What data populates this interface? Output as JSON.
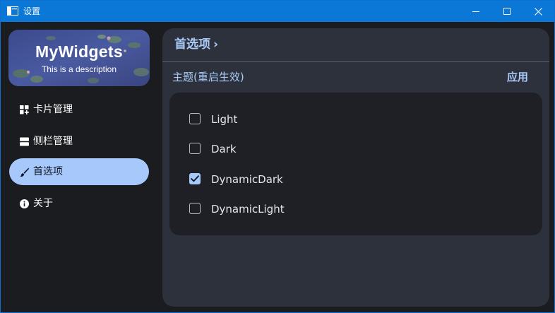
{
  "window": {
    "title": "设置",
    "icon": "app-window-icon",
    "controls": [
      "minimize-icon",
      "maximize-icon",
      "close-icon"
    ]
  },
  "sidebar": {
    "banner": {
      "title": "MyWidgets",
      "description": "This is a description"
    },
    "items": [
      {
        "label": "卡片管理",
        "icon": "grid-plus-icon",
        "active": false
      },
      {
        "label": "侧栏管理",
        "icon": "sidebar-stack-icon",
        "active": false
      },
      {
        "label": "首选项",
        "icon": "brush-icon",
        "active": true
      },
      {
        "label": "关于",
        "icon": "info-icon",
        "active": false
      }
    ]
  },
  "main": {
    "breadcrumb": "首选项",
    "breadcrumb_chevron": "›",
    "section_label": "主题(重启生效)",
    "apply_label": "应用",
    "options": [
      {
        "label": "Light",
        "checked": false
      },
      {
        "label": "Dark",
        "checked": false
      },
      {
        "label": "DynamicDark",
        "checked": true
      },
      {
        "label": "DynamicLight",
        "checked": false
      }
    ]
  },
  "colors": {
    "titlebar": "#0b78d8",
    "accent": "#a6c8fb",
    "content_bg": "#2c313c",
    "card_bg": "#1f2025",
    "sidebar_bg": "#1b1c1f"
  }
}
